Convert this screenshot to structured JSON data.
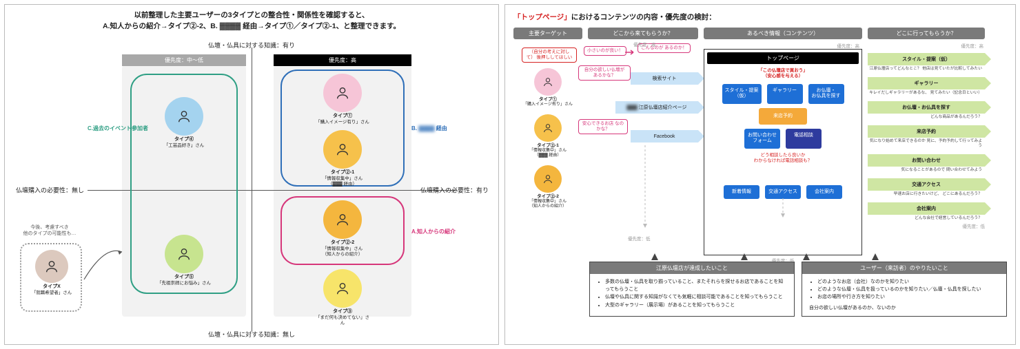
{
  "left": {
    "title_l1": "以前整理した主要ユーザーの3タイプとの整合性・関係性を確認すると、",
    "title_l2": "A.知人からの紹介→タイプ②-2、B. ▓▓▓▓ 経由→タイプ①／タイプ②-1、と整理できます。",
    "axis_top": "仏壇・仏具に対する知識：有り",
    "axis_bottom": "仏壇・仏具に対する知識：無し",
    "axis_left": "仏壇購入の必要性：無し",
    "axis_right": "仏壇購入の必要性：有り",
    "prio_mid": "優先度：中〜低",
    "prio_high": "優先度：高",
    "grp_green": "C.過去のイベント参加者",
    "grp_blue_a": "B.",
    "grp_blue_b": "▓▓▓▓",
    "grp_blue_c": "経由",
    "grp_mag": "A.知人からの紹介",
    "note_l1": "今後、考慮すべき",
    "note_l2": "他のタイプの可能性も…",
    "personas": {
      "p4": {
        "t1": "タイプ④",
        "t2": "「工芸品好き」さん"
      },
      "p5": {
        "t1": "タイプ⑤",
        "t2": "「先祖崇拝にお悩み」さん"
      },
      "p1": {
        "t1": "タイプ①",
        "t2": "「購入イメージ有り」さん"
      },
      "p21": {
        "t1": "タイプ②-1",
        "t2": "「情報収集中」さん",
        "t3": "（▓▓▓ 経由）"
      },
      "p22": {
        "t1": "タイプ②-2",
        "t2": "「情報収集中」さん",
        "t3": "（知人からの紹介）"
      },
      "p3": {
        "t1": "タイプ③",
        "t2": "「まだ何も決めてない」さん"
      },
      "px": {
        "t1": "タイプX",
        "t2": "「就職希望者」さん"
      }
    }
  },
  "right": {
    "title_red": "「トップページ」",
    "title_rest": "におけるコンテンツの内容・優先度の検討：",
    "col1": "主要ターゲット",
    "col2": "どこから来てもらうか？",
    "col3": "あるべき情報（コンテンツ）",
    "col4": "どこに行ってもらうか？",
    "prio_hi": "優先度：高",
    "prio_lo": "優先度：低",
    "bubbles": {
      "b1": "（自分の考えに対して）\n後押ししてほしい",
      "b2": "小さいのが良い！",
      "b3": "こんなのが\nあるのか！",
      "b4": "自分の欲しい仏壇が\nあるかな？",
      "b5": "安心できるお店\nなのかな？"
    },
    "sources": {
      "s1": "検索サイト",
      "s2a": "▓▓▓",
      "s2b": "江原仏壇店紹介ページ",
      "s3": "Facebook"
    },
    "personas": {
      "p1": {
        "t1": "タイプ①",
        "t2": "「購入イメージ有り」さん"
      },
      "p21": {
        "t1": "タイプ②-1",
        "t2": "「情報収集中」さん",
        "t3": "（▓▓▓ 経由）"
      },
      "p22": {
        "t1": "タイプ②-2",
        "t2": "「情報収集中」さん",
        "t3": "（知人からの紹介）"
      }
    },
    "topbox": {
      "head": "トップページ",
      "red1": "「この仏壇店で買おう」\n（安心感を与える）",
      "chips1": [
        "スタイル・提案\n（仮）",
        "ギャラリー",
        "お仏壇・\nお仏具を探す"
      ],
      "visit": "来店予約",
      "chips2": [
        "お問い合わせ\nフォーム",
        "電話相談"
      ],
      "red2": "どう相談したら良いか\nわからなければ電話相談も？",
      "chips3": [
        "新着情報",
        "交通アクセス",
        "会社案内"
      ]
    },
    "dest": [
      {
        "lbl": "スタイル・提案（仮）",
        "note": "江原仏壇店ってどんなとこ？\n他店は見ていたが比較してみたい"
      },
      {
        "lbl": "ギャラリー",
        "note": "キレイだしギャラリーがあるな、\n見てみたい（記念日といい）"
      },
      {
        "lbl": "お仏壇・お仏具を探す",
        "note": "どんな商品があるんだろう？"
      },
      {
        "lbl": "来店予約",
        "note": "気になり始めて来店できるのか\n見に、予約予約して行ってみよう"
      },
      {
        "lbl": "お問い合わせ",
        "note": "気になることがあるので\n問い合わせてみよう"
      },
      {
        "lbl": "交通アクセス",
        "note": "早速お店に行きたいけど、\nどこにあるんだろう？"
      },
      {
        "lbl": "会社案内",
        "note": "どんな会社で経営しているんだろう？"
      }
    ],
    "goal1_head": "江原仏壇店が達成したいこと",
    "goal1_items": [
      "多数の仏壇・仏具を取り揃っていること、またそれらを探せるお店であることを知ってもらうこと",
      "仏壇や仏具に関する知識がなくても気軽に相談可能であることを知ってもらうこと",
      "大型のギャラリー（展示場）があることを知ってもらうこと"
    ],
    "goal2_head": "ユーザー（来訪者）のやりたいこと",
    "goal2_items": [
      "どのようなお店（会社）なのかを知りたい",
      "どのような仏壇・仏具を扱っているのかを知りたい／仏壇・仏具を探したい",
      "お店の場所や行き方を知りたい",
      "自分の欲しい仏壇があるのか、ないのか"
    ]
  }
}
